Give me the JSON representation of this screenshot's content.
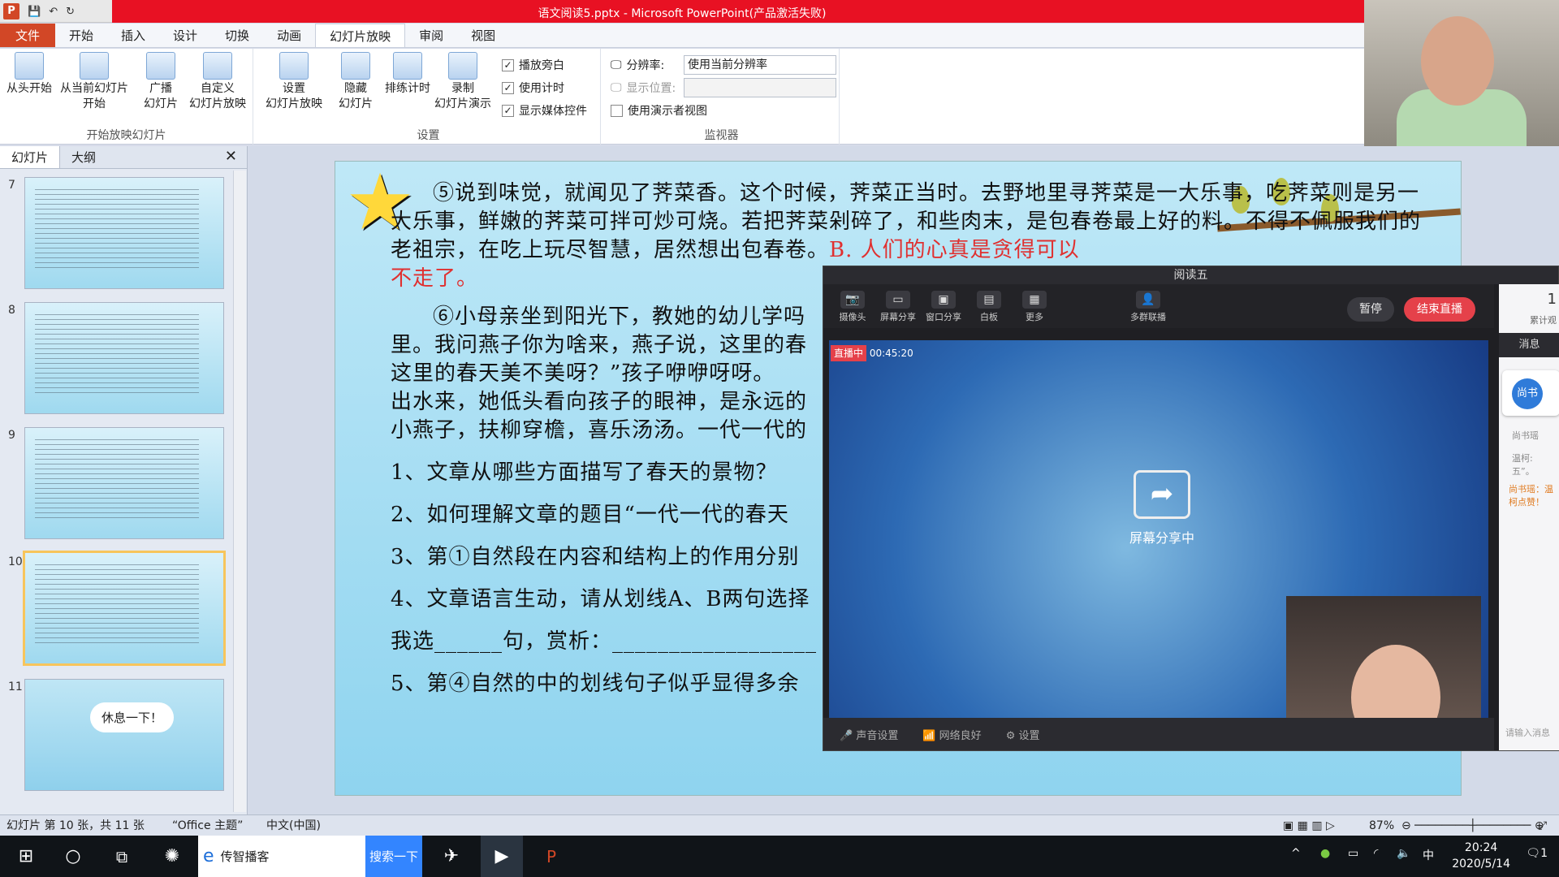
{
  "window": {
    "title": "语文阅读5.pptx - Microsoft PowerPoint(产品激活失败)"
  },
  "tabs": [
    "文件",
    "开始",
    "插入",
    "设计",
    "切换",
    "动画",
    "幻灯片放映",
    "审阅",
    "视图"
  ],
  "ribbon": {
    "from_start": "从头开始",
    "from_current_1": "从当前幻灯片",
    "from_current_2": "开始",
    "broadcast_1": "广播",
    "broadcast_2": "幻灯片",
    "custom_1": "自定义",
    "custom_2": "幻灯片放映",
    "group1": "开始放映幻灯片",
    "setup_1": "设置",
    "setup_2": "幻灯片放映",
    "hide_1": "隐藏",
    "hide_2": "幻灯片",
    "rehearse": "排练计时",
    "record_1": "录制",
    "record_2": "幻灯片演示",
    "narration": "播放旁白",
    "timing": "使用计时",
    "media": "显示媒体控件",
    "group2": "设置",
    "resolution_label": "分辨率:",
    "resolution_value": "使用当前分辨率",
    "display_label": "显示位置:",
    "presenter": "使用演示者视图",
    "group3": "监视器"
  },
  "sidebar": {
    "tab_slides": "幻灯片",
    "tab_outline": "大纲",
    "numbers": [
      "7",
      "8",
      "9",
      "10",
      "11"
    ],
    "slide11_text": "休息一下！"
  },
  "slide": {
    "p1": "⑤说到味觉，就闻见了荠菜香。这个时候，荠菜正当时。去野地里寻荠菜是一大乐事，吃荠菜则是另一大乐事，鲜嫩的荠菜可拌可炒可烧。若把荠菜剁碎了，和些肉末，是包春卷最上好的料。不得不佩服我们的老祖宗，在吃上玩尽智慧，居然想出包春卷。",
    "p1_red": "B. 人们的心真是贪得可以",
    "p1_red2": "不走了。",
    "p2a": "⑥小母亲坐到阳光下，教她的幼儿学吗",
    "p2b": "里。我问燕子你为啥来，燕子说，这里的春",
    "p2c": "这里的春天美不美呀？”孩子咿咿呀呀。",
    "p2d": "出水来，她低头看向孩子的眼神，是永远的",
    "p2e": "小燕子，扶柳穿檐，喜乐汤汤。一代一代的",
    "q1": "1、文章从哪些方面描写了春天的景物？",
    "q2": "2、如何理解文章的题目“一代一代的春天",
    "q3": "3、第①自然段在内容和结构上的作用分别",
    "q4": "4、文章语言生动，请从划线A、B两句选择",
    "q4b": "我选______句，赏析：__________________",
    "q5": "5、第④自然的中的划线句子似乎显得多余"
  },
  "live": {
    "title": "阅读五",
    "tools": [
      "摄像头",
      "屏幕分享",
      "窗口分享",
      "白板",
      "更多",
      "多群联播"
    ],
    "pause": "暂停",
    "end": "结束直播",
    "live_badge": "直播中",
    "timer": "00:45:20",
    "sharing": "屏幕分享中",
    "footer": [
      "声音设置",
      "网络良好",
      "设置"
    ],
    "viewer_count": "1",
    "viewer_label": "累计观",
    "chat_tab": "消息",
    "chat_avatar": "尚书",
    "chat_msgs": [
      "尚书瑶",
      "温柯:",
      "五”。"
    ],
    "chat_red": "尚书瑶：温柯点赞！",
    "chat_input": "请输入消息"
  },
  "status": {
    "slide": "幻灯片 第 10 张，共 11 张",
    "theme": "“Office 主题”",
    "lang": "中文(中国)",
    "zoom": "87%"
  },
  "taskbar": {
    "ie": "传智播客",
    "search": "搜索一下",
    "ime": "中",
    "time": "20:24",
    "date": "2020/5/14",
    "notif": "1"
  }
}
